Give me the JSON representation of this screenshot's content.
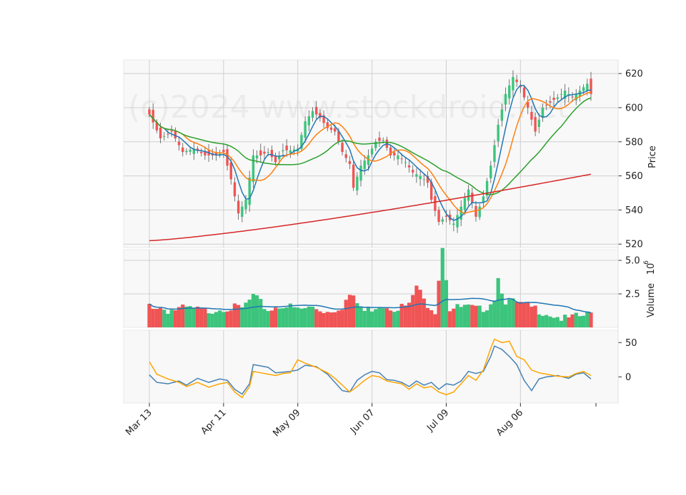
{
  "watermark": "(c)2024 www.stockdroid.net",
  "chart_data": [
    {
      "type": "candlestick",
      "panel": "price",
      "ylabel": "Price",
      "ylim": [
        518,
        628
      ],
      "yticks": [
        520,
        540,
        560,
        580,
        600,
        620
      ],
      "grid": true,
      "x_tick_labels": [
        "Mar 13",
        "Apr 11",
        "May 09",
        "Jun 07",
        "Jul 09",
        "Aug 06"
      ],
      "x_tick_indices": [
        0,
        20,
        40,
        60,
        80,
        100
      ],
      "up_color": "#26a69a",
      "candle_up_color": "#3cc47c",
      "candle_down_color": "#f05454",
      "anchor_closes": [
        [
          0,
          596
        ],
        [
          3,
          582
        ],
        [
          6,
          586
        ],
        [
          9,
          574
        ],
        [
          12,
          576
        ],
        [
          15,
          572
        ],
        [
          18,
          572
        ],
        [
          20,
          574
        ],
        [
          22,
          558
        ],
        [
          24,
          538
        ],
        [
          26,
          546
        ],
        [
          28,
          572
        ],
        [
          30,
          572
        ],
        [
          32,
          574
        ],
        [
          34,
          568
        ],
        [
          36,
          575
        ],
        [
          38,
          575
        ],
        [
          40,
          576
        ],
        [
          42,
          592
        ],
        [
          44,
          598
        ],
        [
          46,
          594
        ],
        [
          48,
          588
        ],
        [
          50,
          586
        ],
        [
          52,
          574
        ],
        [
          54,
          567
        ],
        [
          55,
          553
        ],
        [
          57,
          566
        ],
        [
          59,
          572
        ],
        [
          61,
          580
        ],
        [
          63,
          581
        ],
        [
          65,
          572
        ],
        [
          67,
          572
        ],
        [
          69,
          568
        ],
        [
          71,
          562
        ],
        [
          73,
          560
        ],
        [
          75,
          556
        ],
        [
          76,
          546
        ],
        [
          78,
          533
        ],
        [
          80,
          536
        ],
        [
          82,
          532
        ],
        [
          84,
          542
        ],
        [
          86,
          552
        ],
        [
          88,
          536
        ],
        [
          90,
          548
        ],
        [
          92,
          566
        ],
        [
          94,
          590
        ],
        [
          96,
          608
        ],
        [
          98,
          618
        ],
        [
          100,
          612
        ],
        [
          102,
          600
        ],
        [
          104,
          586
        ],
        [
          106,
          600
        ],
        [
          108,
          603
        ],
        [
          110,
          606
        ],
        [
          112,
          610
        ],
        [
          114,
          606
        ],
        [
          116,
          610
        ],
        [
          118,
          614
        ],
        [
          119,
          608
        ]
      ],
      "moving_averages": [
        {
          "period": 5,
          "color": "#1f77b4"
        },
        {
          "period": 10,
          "color": "#ff7f0e"
        },
        {
          "period": 25,
          "color": "#2ca02c"
        },
        {
          "period": 200,
          "color": "#d62728",
          "start": 522,
          "end": 561
        }
      ]
    },
    {
      "type": "bar",
      "panel": "volume",
      "ylabel": "Volume",
      "ylabel_exponent": "10",
      "ylabel_exponent_power": "6",
      "ylim": [
        0,
        5.8
      ],
      "yticks": [
        2.5,
        5.0
      ],
      "ytick_labels": [
        "2.5",
        "5.0"
      ],
      "moving_average_color": "#1f77b4",
      "volume_anchors": [
        [
          0,
          1.7
        ],
        [
          5,
          1.3
        ],
        [
          10,
          1.4
        ],
        [
          15,
          1.2
        ],
        [
          20,
          1.5
        ],
        [
          25,
          1.4
        ],
        [
          28,
          2.3
        ],
        [
          32,
          1.3
        ],
        [
          36,
          1.7
        ],
        [
          40,
          1.3
        ],
        [
          44,
          1.5
        ],
        [
          48,
          1.2
        ],
        [
          52,
          1.6
        ],
        [
          54,
          2.4
        ],
        [
          58,
          1.2
        ],
        [
          62,
          1.7
        ],
        [
          66,
          1.5
        ],
        [
          70,
          1.6
        ],
        [
          72,
          3.1
        ],
        [
          74,
          2.0
        ],
        [
          77,
          1.3
        ],
        [
          79,
          6.1
        ],
        [
          81,
          1.4
        ],
        [
          85,
          1.5
        ],
        [
          89,
          1.3
        ],
        [
          91,
          1.6
        ],
        [
          93,
          2.2
        ],
        [
          94,
          3.7
        ],
        [
          96,
          2.0
        ],
        [
          100,
          1.7
        ],
        [
          104,
          1.4
        ],
        [
          108,
          1.0
        ],
        [
          112,
          0.6
        ],
        [
          116,
          0.8
        ],
        [
          119,
          1.0
        ]
      ]
    },
    {
      "type": "line",
      "panel": "oscillator",
      "ylim": [
        -38,
        68
      ],
      "yticks": [
        0,
        50
      ],
      "ytick_labels": [
        "0",
        "50"
      ],
      "series": [
        {
          "color": "#4682b4",
          "anchors": [
            [
              0,
              3
            ],
            [
              2,
              -8
            ],
            [
              5,
              -10
            ],
            [
              8,
              -6
            ],
            [
              10,
              -12
            ],
            [
              13,
              -2
            ],
            [
              16,
              -8
            ],
            [
              19,
              -3
            ],
            [
              21,
              -5
            ],
            [
              23,
              -18
            ],
            [
              25,
              -25
            ],
            [
              27,
              -10
            ],
            [
              28,
              18
            ],
            [
              30,
              16
            ],
            [
              32,
              14
            ],
            [
              34,
              6
            ],
            [
              36,
              7
            ],
            [
              38,
              8
            ],
            [
              40,
              10
            ],
            [
              42,
              17
            ],
            [
              45,
              15
            ],
            [
              48,
              4
            ],
            [
              50,
              -8
            ],
            [
              52,
              -20
            ],
            [
              54,
              -22
            ],
            [
              56,
              -5
            ],
            [
              58,
              3
            ],
            [
              60,
              8
            ],
            [
              62,
              6
            ],
            [
              64,
              -4
            ],
            [
              66,
              -5
            ],
            [
              68,
              -8
            ],
            [
              70,
              -14
            ],
            [
              72,
              -6
            ],
            [
              74,
              -12
            ],
            [
              76,
              -8
            ],
            [
              78,
              -18
            ],
            [
              80,
              -10
            ],
            [
              82,
              -12
            ],
            [
              84,
              -6
            ],
            [
              86,
              8
            ],
            [
              88,
              5
            ],
            [
              90,
              8
            ],
            [
              92,
              30
            ],
            [
              93,
              45
            ],
            [
              95,
              40
            ],
            [
              97,
              30
            ],
            [
              99,
              18
            ],
            [
              101,
              -5
            ],
            [
              103,
              -20
            ],
            [
              105,
              -3
            ],
            [
              107,
              0
            ],
            [
              110,
              2
            ],
            [
              113,
              -2
            ],
            [
              115,
              4
            ],
            [
              117,
              6
            ],
            [
              119,
              -3
            ]
          ]
        },
        {
          "color": "#ffa500",
          "anchors": [
            [
              0,
              22
            ],
            [
              2,
              4
            ],
            [
              5,
              -3
            ],
            [
              8,
              -8
            ],
            [
              10,
              -14
            ],
            [
              13,
              -8
            ],
            [
              16,
              -15
            ],
            [
              19,
              -10
            ],
            [
              21,
              -8
            ],
            [
              23,
              -22
            ],
            [
              25,
              -30
            ],
            [
              27,
              -14
            ],
            [
              28,
              8
            ],
            [
              30,
              6
            ],
            [
              32,
              4
            ],
            [
              34,
              2
            ],
            [
              36,
              5
            ],
            [
              38,
              6
            ],
            [
              40,
              25
            ],
            [
              42,
              20
            ],
            [
              45,
              14
            ],
            [
              48,
              6
            ],
            [
              50,
              -2
            ],
            [
              52,
              -12
            ],
            [
              54,
              -22
            ],
            [
              56,
              -14
            ],
            [
              58,
              -5
            ],
            [
              60,
              2
            ],
            [
              62,
              0
            ],
            [
              64,
              -6
            ],
            [
              66,
              -8
            ],
            [
              68,
              -10
            ],
            [
              70,
              -18
            ],
            [
              72,
              -10
            ],
            [
              74,
              -16
            ],
            [
              76,
              -14
            ],
            [
              78,
              -22
            ],
            [
              80,
              -26
            ],
            [
              82,
              -22
            ],
            [
              84,
              -10
            ],
            [
              86,
              2
            ],
            [
              88,
              -5
            ],
            [
              90,
              10
            ],
            [
              92,
              42
            ],
            [
              93,
              55
            ],
            [
              95,
              50
            ],
            [
              97,
              52
            ],
            [
              99,
              30
            ],
            [
              101,
              25
            ],
            [
              103,
              10
            ],
            [
              105,
              6
            ],
            [
              107,
              4
            ],
            [
              110,
              1
            ],
            [
              113,
              0
            ],
            [
              115,
              5
            ],
            [
              117,
              8
            ],
            [
              119,
              2
            ]
          ]
        }
      ]
    }
  ]
}
